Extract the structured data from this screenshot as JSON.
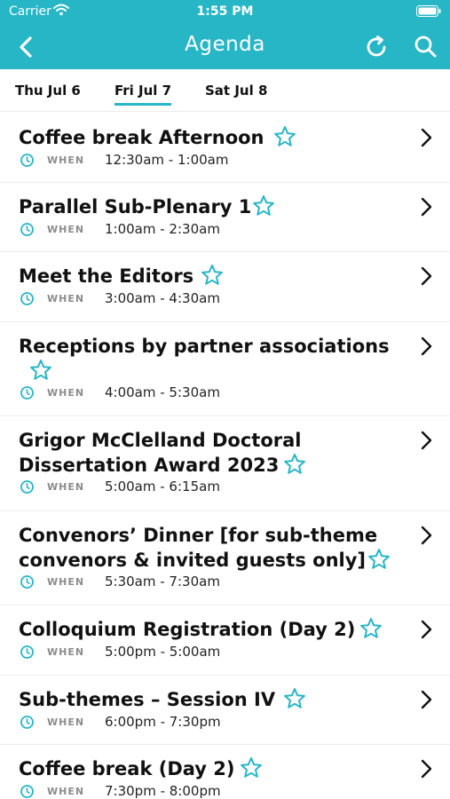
{
  "status_bar": {
    "carrier": "Carrier",
    "time": "1:55 PM"
  },
  "nav": {
    "title": "Agenda",
    "back_icon": "chevron-left-icon",
    "refresh_icon": "refresh-icon",
    "search_icon": "search-icon"
  },
  "colors": {
    "accent": "#27b6c5",
    "header_bg": "#27b6c5",
    "text": "#111111",
    "muted": "#8c8c8c",
    "divider": "#ececec"
  },
  "tabs": [
    {
      "label": "Thu Jul 6",
      "selected": false
    },
    {
      "label": "Fri Jul 7",
      "selected": true
    },
    {
      "label": "Sat Jul 8",
      "selected": false
    }
  ],
  "when_label": "WHEN",
  "sessions": [
    {
      "title_lines": [
        "Coffee break Afternoon"
      ],
      "time": "12:30am - 1:00am"
    },
    {
      "title_lines": [
        "Parallel Sub-Plenary 1"
      ],
      "time": "1:00am - 2:30am"
    },
    {
      "title_lines": [
        "Meet the Editors"
      ],
      "time": "3:00am - 4:30am"
    },
    {
      "title_lines": [
        "Receptions by partner associations"
      ],
      "time": "4:00am - 5:30am"
    },
    {
      "title_lines": [
        "Grigor McClelland Doctoral",
        "Dissertation Award 2023"
      ],
      "time": "5:00am - 6:15am"
    },
    {
      "title_lines": [
        "Convenors’ Dinner [for sub-theme",
        "convenors & invited guests only]"
      ],
      "time": "5:30am - 7:30am"
    },
    {
      "title_lines": [
        "Colloquium Registration (Day 2)"
      ],
      "time": "5:00pm - 5:00am"
    },
    {
      "title_lines": [
        "Sub-themes – Session IV"
      ],
      "time": "6:00pm - 7:30pm"
    },
    {
      "title_lines": [
        "Coffee break (Day 2)"
      ],
      "time": "7:30pm - 8:00pm"
    }
  ]
}
